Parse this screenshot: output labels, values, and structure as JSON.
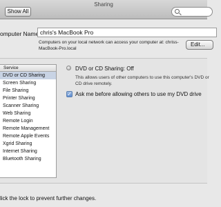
{
  "window": {
    "title": "Sharing"
  },
  "toolbar": {
    "back_icon": "chevron-left-icon",
    "forward_icon": "chevron-right-icon",
    "show_all_label": "Show All",
    "search_icon": "magnifier-icon"
  },
  "computer_name": {
    "label": "omputer Name:",
    "value": "chris's MacBook Pro",
    "info": "Computers on your local network can access your computer at: chriss-MacBook-Pro.local",
    "edit_label": "Edit..."
  },
  "services": {
    "header": "Service",
    "items": [
      "DVD or CD Sharing",
      "Screen Sharing",
      "File Sharing",
      "Printer Sharing",
      "Scanner Sharing",
      "Web Sharing",
      "Remote Login",
      "Remote Management",
      "Remote Apple Events",
      "Xgrid Sharing",
      "Internet Sharing",
      "Bluetooth Sharing"
    ],
    "selected_index": 0
  },
  "detail": {
    "status": "DVD or CD Sharing: Off",
    "description": "This allows users of other computers to use this computer's DVD or CD drive remotely.",
    "ask_checkbox_label": "Ask me before allowing others to use my DVD drive",
    "ask_checked": true
  },
  "footer": {
    "lock_text": "lick the lock to prevent further changes."
  },
  "colors": {
    "selection": "#c8d3e4",
    "checkbox": "#5d8cd0"
  }
}
